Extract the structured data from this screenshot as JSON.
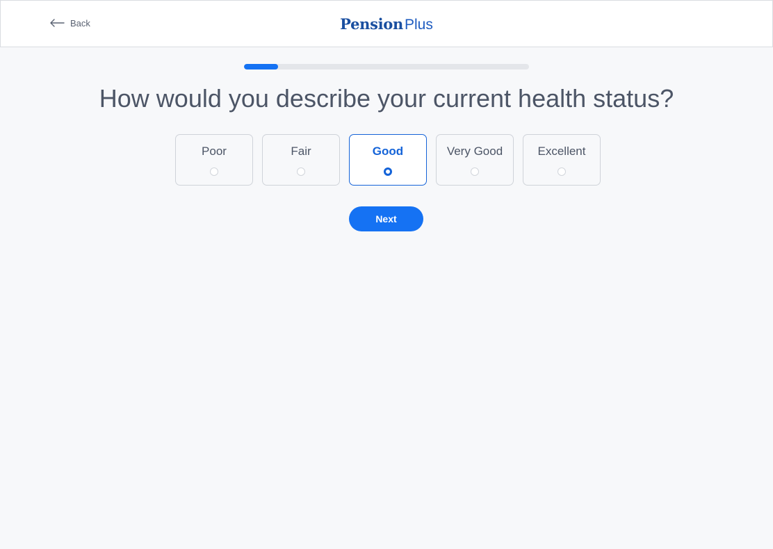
{
  "header": {
    "back_label": "Back",
    "back_icon": "arrow-left-icon",
    "logo_bold": "Pension",
    "logo_light": "Plus",
    "brand_color": "#1a4fa0"
  },
  "progress": {
    "percent": 12
  },
  "question": "How would you describe your current health status?",
  "options": [
    {
      "label": "Poor",
      "selected": false
    },
    {
      "label": "Fair",
      "selected": false
    },
    {
      "label": "Good",
      "selected": true
    },
    {
      "label": "Very Good",
      "selected": false
    },
    {
      "label": "Excellent",
      "selected": false
    }
  ],
  "next_label": "Next",
  "colors": {
    "accent": "#1572f3",
    "selected": "#1463d8",
    "background": "#f7f8fa",
    "text": "#4c5566"
  }
}
